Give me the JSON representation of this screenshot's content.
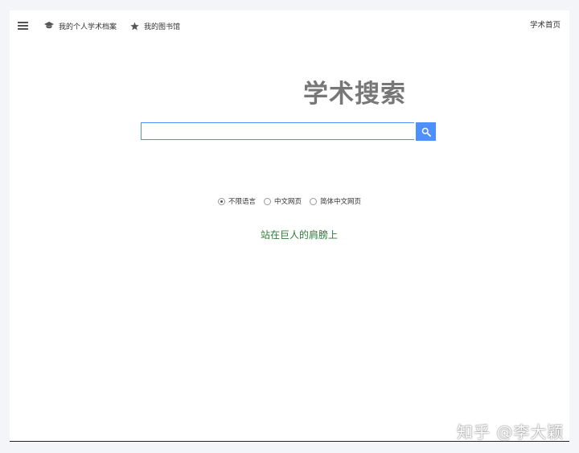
{
  "header": {
    "profile_link": "我的个人学术档案",
    "library_link": "我的图书馆",
    "home_link": "学术首页"
  },
  "logo": {
    "title": "学术搜索"
  },
  "search": {
    "value": "",
    "placeholder": "",
    "button_icon": "search-icon",
    "button_color": "#4d90fe"
  },
  "language_filter": {
    "options": [
      {
        "label": "不限语言",
        "checked": true
      },
      {
        "label": "中文网页",
        "checked": false
      },
      {
        "label": "简体中文网页",
        "checked": false
      }
    ]
  },
  "slogan": "站在巨人的肩膀上",
  "watermark": "知乎 @李大颖",
  "colors": {
    "accent": "#4d90fe",
    "slogan": "#2f7a3a",
    "logo": "#777777"
  }
}
